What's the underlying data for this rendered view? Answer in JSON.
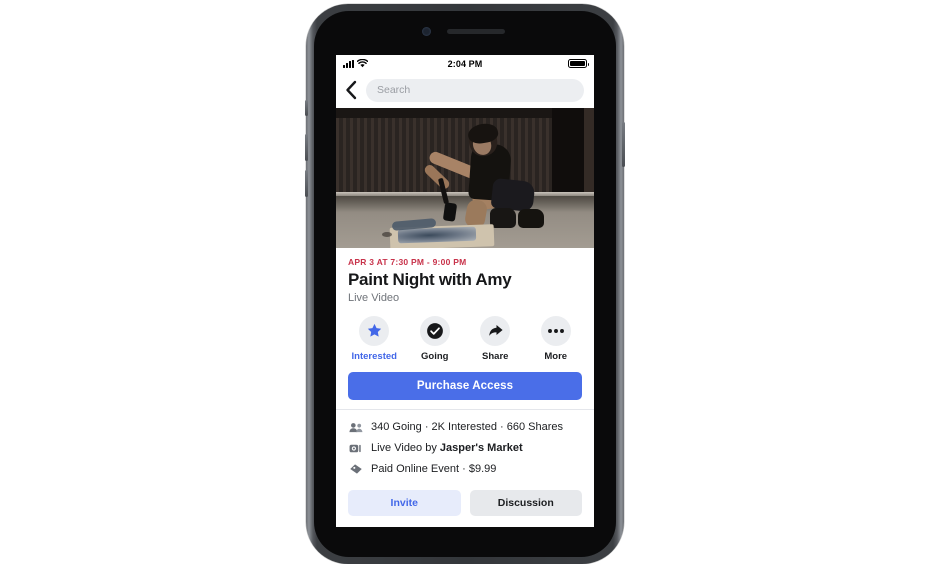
{
  "status_bar": {
    "time": "2:04 PM",
    "signal_icon": "cellular-bars-icon",
    "wifi_icon": "wifi-icon",
    "battery_icon": "battery-full-icon"
  },
  "nav_bar": {
    "back_icon": "chevron-left-icon",
    "search_placeholder": "Search",
    "search_value": ""
  },
  "cover": {
    "alt": "woman crouching painting on a board on a concrete floor"
  },
  "event": {
    "date": "APR 3 AT 7:30 PM - 9:00 PM",
    "title": "Paint Night with Amy",
    "subtitle": "Live Video"
  },
  "actions": [
    {
      "label": "Interested",
      "icon": "star-icon",
      "accent": true
    },
    {
      "label": "Going",
      "icon": "check-circle-icon",
      "accent": false
    },
    {
      "label": "Share",
      "icon": "share-arrow-icon",
      "accent": false
    },
    {
      "label": "More",
      "icon": "ellipsis-icon",
      "accent": false
    }
  ],
  "cta": {
    "purchase_label": "Purchase Access"
  },
  "details": [
    {
      "icon": "people-icon",
      "text": "340 Going · 2K Interested · 660 Shares"
    },
    {
      "icon": "video-camera-icon",
      "text_prefix": "Live Video by ",
      "text_bold": "Jasper's Market"
    },
    {
      "icon": "price-tag-icon",
      "text": "Paid Online Event · $9.99"
    }
  ],
  "bottom_buttons": [
    {
      "label": "Invite",
      "style": "primary"
    },
    {
      "label": "Discussion",
      "style": "secondary"
    }
  ],
  "colors": {
    "accent_blue": "#4267e8",
    "cta_blue": "#4a6ee8",
    "date_red": "#c8324a",
    "chip_gray": "#ebedf0",
    "text_primary": "#1c1e21",
    "text_secondary": "#70747a"
  }
}
